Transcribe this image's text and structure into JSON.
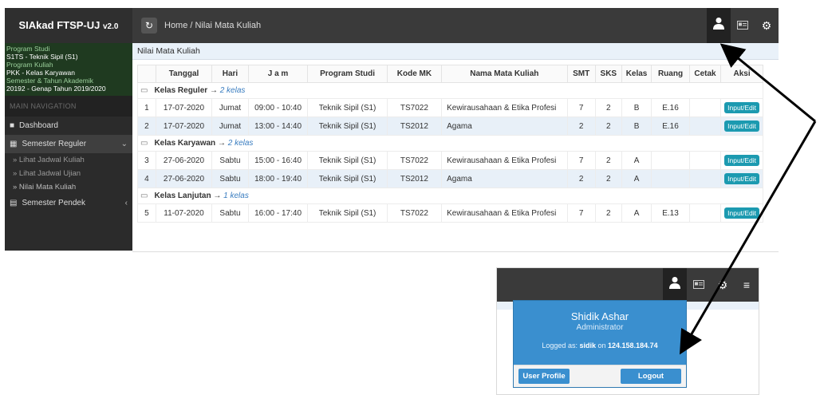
{
  "header": {
    "brand": "SIAkad FTSP-UJ",
    "brand_version": "v2.0",
    "breadcrumb_home": "Home",
    "breadcrumb_sep": "/",
    "breadcrumb_current": "Nilai Mata Kuliah"
  },
  "sidebar": {
    "info": [
      {
        "label": "Program Studi",
        "value": "S1TS - Teknik Sipil (S1)"
      },
      {
        "label": "Program Kuliah",
        "value": "PKK - Kelas Karyawan"
      },
      {
        "label": "Semester & Tahun Akademik",
        "value": "20192 - Genap Tahun 2019/2020"
      }
    ],
    "nav_heading": "MAIN NAVIGATION",
    "items": [
      {
        "label": "Dashboard"
      },
      {
        "label": "Semester Reguler"
      },
      {
        "label": "Semester Pendek"
      }
    ],
    "subitems": [
      {
        "label": "» Lihat Jadwal Kuliah"
      },
      {
        "label": "» Lihat Jadwal Ujian"
      },
      {
        "label": "» Nilai Mata Kuliah"
      }
    ]
  },
  "main": {
    "title": "Nilai Mata Kuliah",
    "columns": [
      "Tanggal",
      "Hari",
      "J a m",
      "Program Studi",
      "Kode MK",
      "Nama Mata Kuliah",
      "SMT",
      "SKS",
      "Kelas",
      "Ruang",
      "Cetak",
      "Aksi"
    ],
    "groups": [
      {
        "title": "Kelas Reguler",
        "count": "2 kelas",
        "rows": [
          {
            "no": "1",
            "tanggal": "17-07-2020",
            "hari": "Jumat",
            "jam": "09:00 - 10:40",
            "prodi": "Teknik Sipil (S1)",
            "kode": "TS7022",
            "nama": "Kewirausahaan & Etika Profesi",
            "smt": "7",
            "sks": "2",
            "kelas": "B",
            "ruang": "E.16",
            "cetak": ""
          },
          {
            "no": "2",
            "tanggal": "17-07-2020",
            "hari": "Jumat",
            "jam": "13:00 - 14:40",
            "prodi": "Teknik Sipil (S1)",
            "kode": "TS2012",
            "nama": "Agama",
            "smt": "2",
            "sks": "2",
            "kelas": "B",
            "ruang": "E.16",
            "cetak": ""
          }
        ]
      },
      {
        "title": "Kelas Karyawan",
        "count": "2 kelas",
        "rows": [
          {
            "no": "3",
            "tanggal": "27-06-2020",
            "hari": "Sabtu",
            "jam": "15:00 - 16:40",
            "prodi": "Teknik Sipil (S1)",
            "kode": "TS7022",
            "nama": "Kewirausahaan & Etika Profesi",
            "smt": "7",
            "sks": "2",
            "kelas": "A",
            "ruang": "",
            "cetak": ""
          },
          {
            "no": "4",
            "tanggal": "27-06-2020",
            "hari": "Sabtu",
            "jam": "18:00 - 19:40",
            "prodi": "Teknik Sipil (S1)",
            "kode": "TS2012",
            "nama": "Agama",
            "smt": "2",
            "sks": "2",
            "kelas": "A",
            "ruang": "",
            "cetak": ""
          }
        ]
      },
      {
        "title": "Kelas Lanjutan",
        "count": "1 kelas",
        "rows": [
          {
            "no": "5",
            "tanggal": "11-07-2020",
            "hari": "Sabtu",
            "jam": "16:00 - 17:40",
            "prodi": "Teknik Sipil (S1)",
            "kode": "TS7022",
            "nama": "Kewirausahaan & Etika Profesi",
            "smt": "7",
            "sks": "2",
            "kelas": "A",
            "ruang": "E.13",
            "cetak": ""
          }
        ]
      }
    ],
    "action_label": "Input/Edit"
  },
  "user_menu": {
    "name": "Shidik Ashar",
    "role": "Administrator",
    "logged_prefix": "Logged as:",
    "username": "sidik",
    "on": "on",
    "ip": "124.158.184.74",
    "profile_label": "User Profile",
    "logout_label": "Logout"
  },
  "icons": {
    "refresh": "refresh-icon",
    "user": "user-icon",
    "card": "id-card-icon",
    "settings": "cogs-icon",
    "menu": "hamburger-icon"
  },
  "colors": {
    "accent": "#3a8fcf",
    "button": "#1c9ab0",
    "header": "#3a3a3a",
    "sidebar": "#2b2b2b"
  }
}
